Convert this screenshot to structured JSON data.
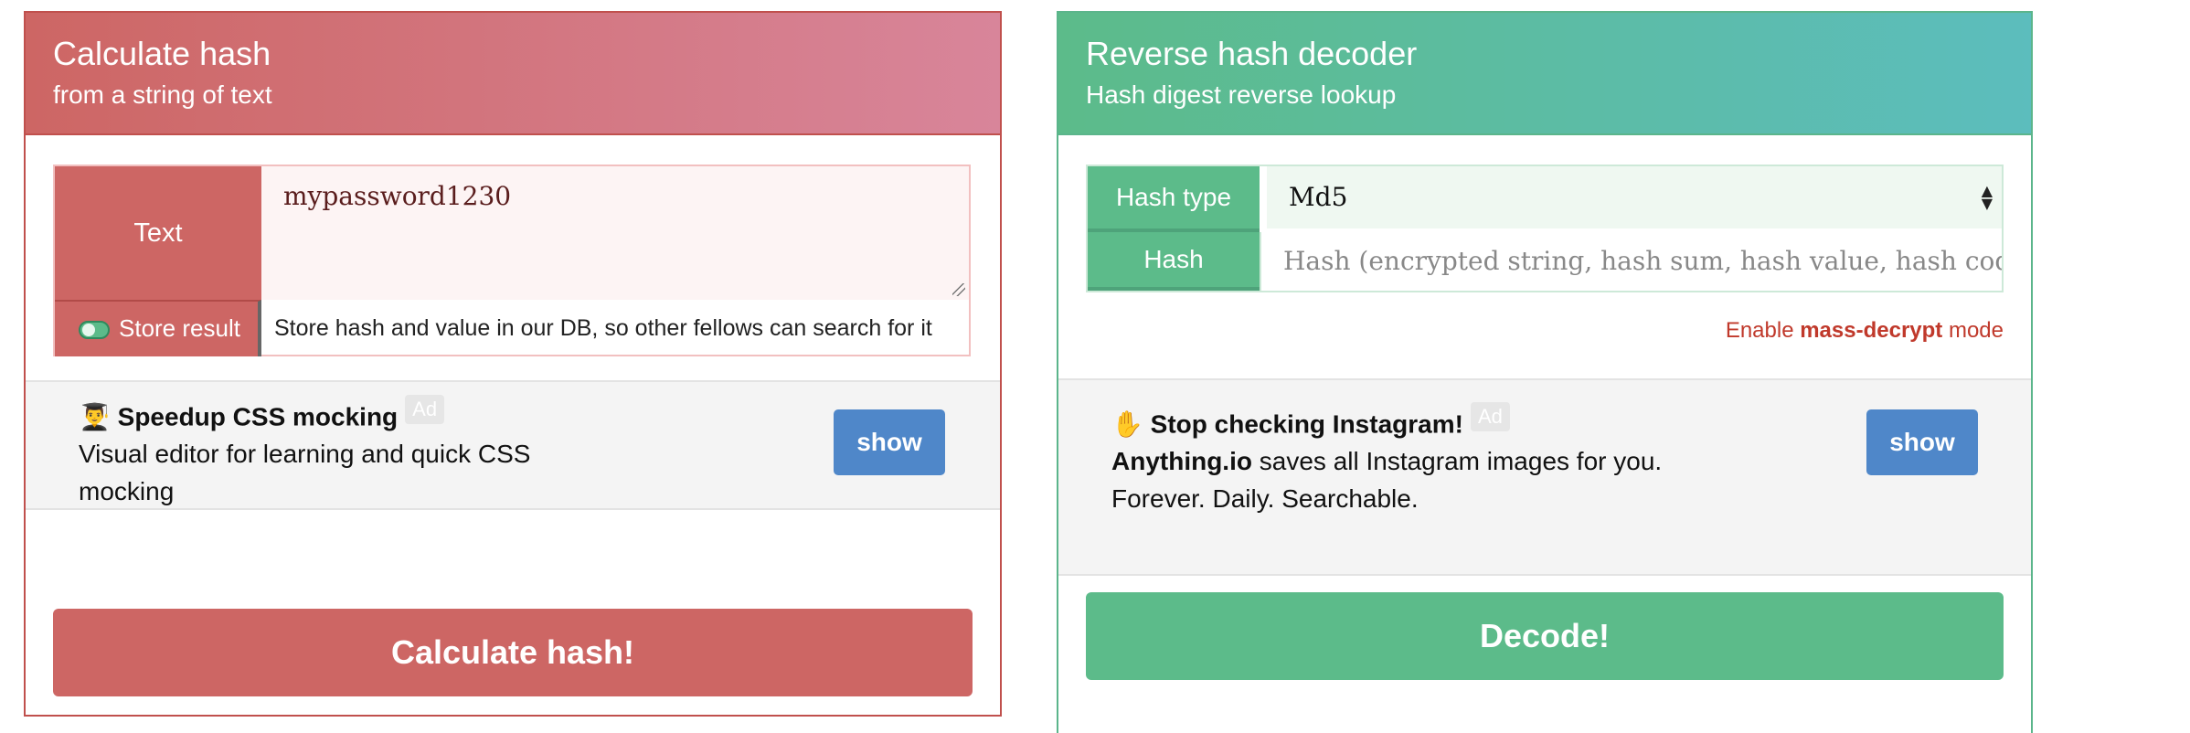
{
  "left": {
    "title": "Calculate hash",
    "subtitle": "from a string of text",
    "text_label": "Text",
    "text_value": "mypassword1230",
    "store_label": "Store result",
    "store_desc": "Store hash and value in our DB, so other fellows can search for it",
    "ad": {
      "emoji": "👨‍🎓",
      "title": "Speedup CSS mocking",
      "badge": "Ad",
      "line1": "Visual editor for learning and quick CSS",
      "line2": "mocking",
      "button": "show"
    },
    "submit": "Calculate hash!"
  },
  "right": {
    "title": "Reverse hash decoder",
    "subtitle": "Hash digest reverse lookup",
    "hash_type_label": "Hash type",
    "hash_type_value": "Md5",
    "hash_label": "Hash",
    "hash_placeholder": "Hash (encrypted string, hash sum, hash value, hash code",
    "mass_prefix": "Enable ",
    "mass_bold": "mass-decrypt",
    "mass_suffix": " mode",
    "ad": {
      "emoji": "✋",
      "title": "Stop checking Instagram!",
      "badge": "Ad",
      "brand": "Anything.io",
      "line1_rest": " saves all Instagram images for you.",
      "line2": "Forever. Daily. Searchable.",
      "button": "show"
    },
    "submit": "Decode!"
  },
  "colors": {
    "left_accent": "#cd6664",
    "right_accent": "#5cbb8a",
    "ad_button": "#4f87c9"
  }
}
